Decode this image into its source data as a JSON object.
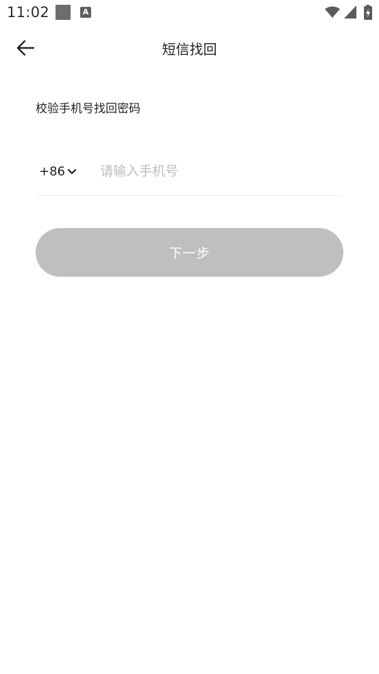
{
  "status_bar": {
    "time": "11:02",
    "notification_badge": "A"
  },
  "header": {
    "title": "短信找回"
  },
  "main": {
    "subtitle": "校验手机号找回密码",
    "country_code": "+86",
    "phone_input": {
      "value": "",
      "placeholder": "请输入手机号"
    },
    "next_button_label": "下一步"
  },
  "colors": {
    "button_disabled_bg": "#bfbfbf",
    "placeholder": "#bdbdbd",
    "divider": "#ececec"
  }
}
